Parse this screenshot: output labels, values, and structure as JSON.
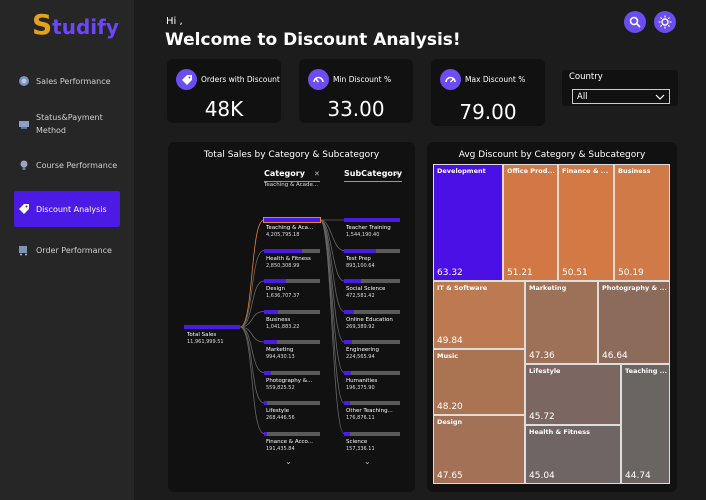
{
  "app": {
    "logo_initial": "S",
    "logo_rest": "tudify"
  },
  "sidebar": {
    "items": [
      {
        "label": "Sales Performance",
        "icon": "coin-icon",
        "active": false
      },
      {
        "label": "Status&Payment Method",
        "icon": "payment-icon",
        "active": false
      },
      {
        "label": "Course Performance",
        "icon": "course-icon",
        "active": false
      },
      {
        "label": "Discount Analysis",
        "icon": "discount-tag-icon",
        "active": true
      },
      {
        "label": "Order Performance",
        "icon": "order-icon",
        "active": false
      }
    ]
  },
  "header": {
    "greeting": "Hi ,",
    "title": "Welcome to Discount Analysis!",
    "search_icon": "search-icon",
    "theme_icon": "sun-icon"
  },
  "kpis": [
    {
      "label": "Orders with Discount",
      "value": "48K",
      "icon": "tag-icon"
    },
    {
      "label": "Min Discount %",
      "value": "33.00",
      "icon": "gauge-low-icon"
    },
    {
      "label": "Max Discount %",
      "value": "79.00",
      "icon": "gauge-high-icon"
    }
  ],
  "country_filter": {
    "label": "Country",
    "value": "All"
  },
  "decomposition_tree": {
    "title": "Total Sales by Category & Subcategory",
    "category_header": "Category",
    "category_selected": "Teaching & Acade...",
    "subcategory_header": "SubCategory",
    "root": {
      "label": "Total Sales",
      "value": "11,961,999.51"
    },
    "categories": [
      {
        "label": "Teaching & Aca...",
        "value": "4,205,795.18",
        "share": 1.0,
        "selected": true
      },
      {
        "label": "Health & Fitness",
        "value": "2,850,308.99",
        "share": 0.68,
        "selected": false
      },
      {
        "label": "Design",
        "value": "1,636,707.37",
        "share": 0.39,
        "selected": false
      },
      {
        "label": "Business",
        "value": "1,041,883.22",
        "share": 0.25,
        "selected": false
      },
      {
        "label": "Marketing",
        "value": "994,430.13",
        "share": 0.24,
        "selected": false
      },
      {
        "label": "Photography &...",
        "value": "559,825.52",
        "share": 0.13,
        "selected": false
      },
      {
        "label": "Lifestyle",
        "value": "268,446.56",
        "share": 0.06,
        "selected": false
      },
      {
        "label": "Finance & Acco...",
        "value": "191,435.84",
        "share": 0.05,
        "selected": false
      }
    ],
    "subcategories": [
      {
        "label": "Teacher Training",
        "value": "1,544,190.40",
        "share": 1.0
      },
      {
        "label": "Test Prep",
        "value": "893,100.64",
        "share": 0.58
      },
      {
        "label": "Social Science",
        "value": "472,581.42",
        "share": 0.31
      },
      {
        "label": "Online Education",
        "value": "269,389.92",
        "share": 0.17
      },
      {
        "label": "Engineering",
        "value": "224,565.94",
        "share": 0.15
      },
      {
        "label": "Humanities",
        "value": "196,375.90",
        "share": 0.13
      },
      {
        "label": "Other Teaching...",
        "value": "176,876.11",
        "share": 0.11
      },
      {
        "label": "Science",
        "value": "157,336.11",
        "share": 0.1
      }
    ]
  },
  "treemap": {
    "title": "Avg Discount by Category & Subcategory",
    "cells": [
      {
        "label": "Development",
        "value": "63.32",
        "color": "#4b10e6"
      },
      {
        "label": "Office Prod...",
        "value": "51.21",
        "color": "#d27844"
      },
      {
        "label": "Finance & ...",
        "value": "50.51",
        "color": "#d27944"
      },
      {
        "label": "Business",
        "value": "50.19",
        "color": "#cf7a47"
      },
      {
        "label": "IT & Software",
        "value": "49.84",
        "color": "#bd7a50"
      },
      {
        "label": "Marketing",
        "value": "47.36",
        "color": "#9d7058"
      },
      {
        "label": "Photography & ...",
        "value": "46.64",
        "color": "#8d6b5b"
      },
      {
        "label": "Music",
        "value": "48.20",
        "color": "#aa7352"
      },
      {
        "label": "Lifestyle",
        "value": "45.72",
        "color": "#7b6661"
      },
      {
        "label": "Teaching ...",
        "value": "44.74",
        "color": "#6a6463"
      },
      {
        "label": "Design",
        "value": "47.65",
        "color": "#a37156"
      },
      {
        "label": "Health & Fitness",
        "value": "45.04",
        "color": "#6f6564"
      }
    ]
  }
}
